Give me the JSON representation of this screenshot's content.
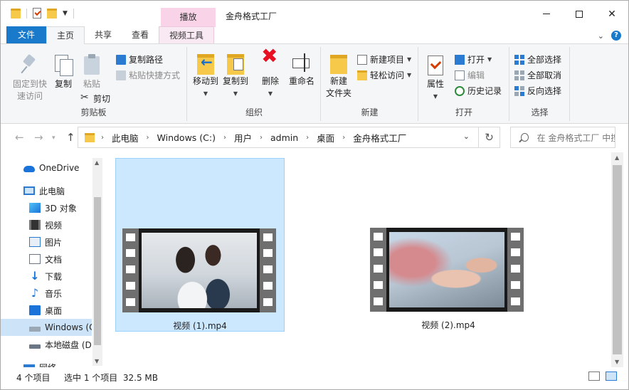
{
  "window": {
    "title": "金舟格式工厂",
    "contextual_tab_header": "播放",
    "controls": {
      "minimize": "—",
      "maximize": "☐",
      "close": "✕"
    }
  },
  "tabs": [
    {
      "label": "文件"
    },
    {
      "label": "主页"
    },
    {
      "label": "共享"
    },
    {
      "label": "查看"
    },
    {
      "label": "视频工具"
    }
  ],
  "ribbon": {
    "clipboard": {
      "label": "剪贴板",
      "pin": "固定到快\n速访问",
      "copy": "复制",
      "paste": "粘贴",
      "copy_path": "复制路径",
      "paste_shortcut": "粘贴快捷方式",
      "cut": "剪切"
    },
    "organize": {
      "label": "组织",
      "move_to": "移动到",
      "copy_to": "复制到",
      "delete": "删除",
      "rename": "重命名"
    },
    "new": {
      "label": "新建",
      "new_folder": "新建\n文件夹",
      "new_item": "新建项目",
      "easy_access": "轻松访问"
    },
    "open": {
      "label": "打开",
      "properties": "属性",
      "open": "打开",
      "edit": "编辑",
      "history": "历史记录"
    },
    "select": {
      "label": "选择",
      "select_all": "全部选择",
      "select_none": "全部取消",
      "invert": "反向选择"
    }
  },
  "address": {
    "crumbs": [
      "此电脑",
      "Windows (C:)",
      "用户",
      "admin",
      "桌面",
      "金舟格式工厂"
    ],
    "search_placeholder": "在 金舟格式工厂 中搜索"
  },
  "nav_pane": {
    "items": [
      {
        "label": "OneDrive",
        "icon": "cloud-icon"
      },
      {
        "label": "此电脑",
        "icon": "pc-icon"
      },
      {
        "label": "3D 对象",
        "icon": "3d-objects-icon"
      },
      {
        "label": "视频",
        "icon": "video-icon"
      },
      {
        "label": "图片",
        "icon": "pictures-icon"
      },
      {
        "label": "文档",
        "icon": "documents-icon"
      },
      {
        "label": "下载",
        "icon": "download-icon"
      },
      {
        "label": "音乐",
        "icon": "music-icon"
      },
      {
        "label": "桌面",
        "icon": "desktop-icon"
      },
      {
        "label": "Windows (C:)",
        "icon": "drive-icon"
      },
      {
        "label": "本地磁盘 (D:)",
        "icon": "drive-icon"
      },
      {
        "label": "网络",
        "icon": "network-icon"
      }
    ]
  },
  "files": [
    {
      "name": "视频 (1).mp4",
      "selected": true
    },
    {
      "name": "视频 (2).mp4",
      "selected": false
    }
  ],
  "status": {
    "item_count": "4 个项目",
    "selection": "选中 1 个项目  32.5 MB"
  },
  "colors": {
    "accent": "#1979ca",
    "selection": "#cce8ff",
    "contextual": "#f9d4e8"
  }
}
